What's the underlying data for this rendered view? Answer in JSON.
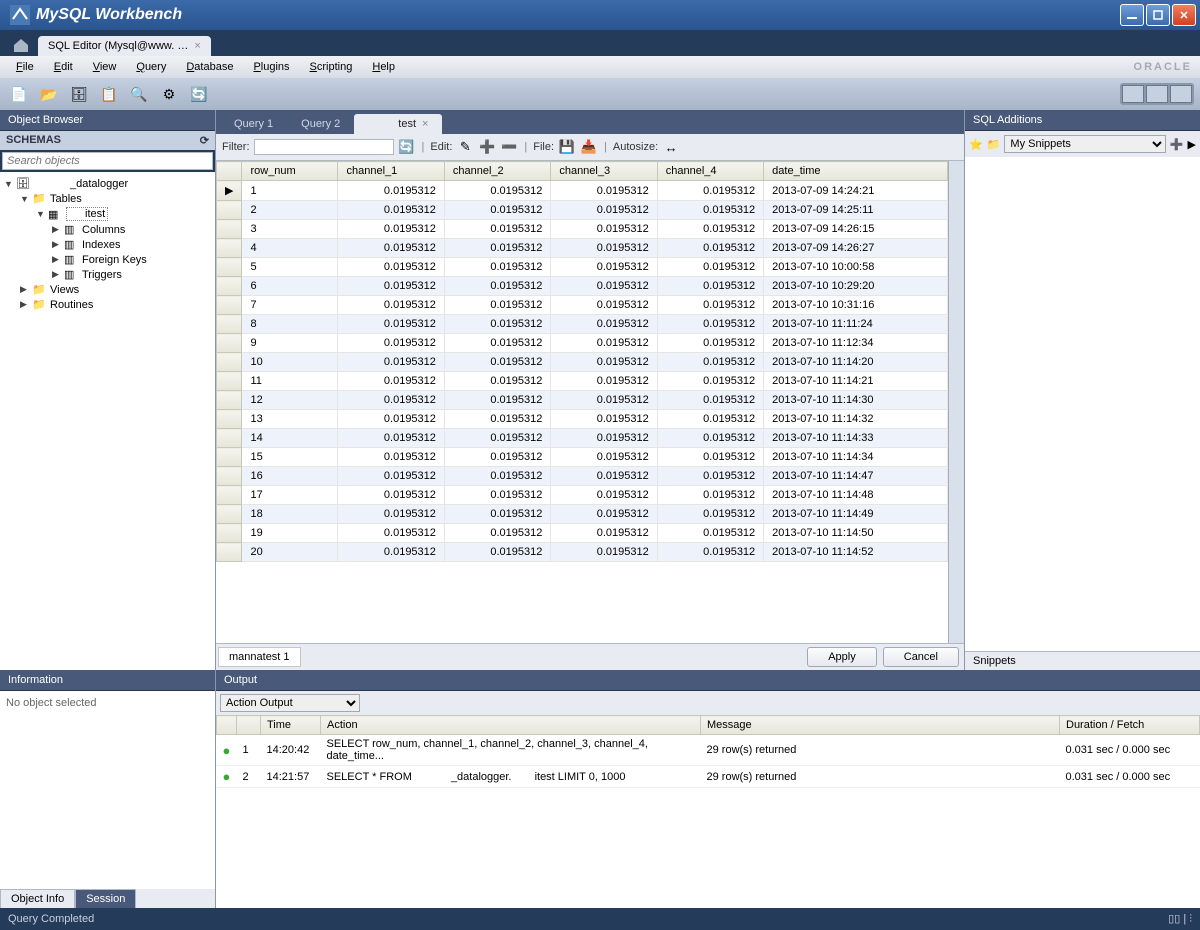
{
  "window": {
    "title": "MySQL Workbench"
  },
  "top_tab": {
    "label": "SQL Editor (Mysql@www. …"
  },
  "menu": [
    "File",
    "Edit",
    "View",
    "Query",
    "Database",
    "Plugins",
    "Scripting",
    "Help"
  ],
  "brand": "ORACLE",
  "object_browser": {
    "title": "Object Browser",
    "schemas_label": "SCHEMAS",
    "search_placeholder": "Search objects",
    "tree": {
      "db_suffix": "_datalogger",
      "tables": "Tables",
      "table_suffix": "itest",
      "columns": "Columns",
      "indexes": "Indexes",
      "foreign_keys": "Foreign Keys",
      "triggers": "Triggers",
      "views": "Views",
      "routines": "Routines"
    }
  },
  "information": {
    "title": "Information",
    "body": "No object selected"
  },
  "info_tabs": {
    "object": "Object Info",
    "session": "Session"
  },
  "query_tabs": {
    "q1": "Query 1",
    "q2": "Query 2",
    "active_suffix": "test"
  },
  "filter_bar": {
    "filter": "Filter:",
    "edit": "Edit:",
    "file": "File:",
    "autosize": "Autosize:"
  },
  "grid": {
    "columns": [
      "row_num",
      "channel_1",
      "channel_2",
      "channel_3",
      "channel_4",
      "date_time"
    ],
    "rows": [
      {
        "n": 1,
        "c": "0.0195312",
        "dt": "2013-07-09 14:24:21"
      },
      {
        "n": 2,
        "c": "0.0195312",
        "dt": "2013-07-09 14:25:11"
      },
      {
        "n": 3,
        "c": "0.0195312",
        "dt": "2013-07-09 14:26:15"
      },
      {
        "n": 4,
        "c": "0.0195312",
        "dt": "2013-07-09 14:26:27"
      },
      {
        "n": 5,
        "c": "0.0195312",
        "dt": "2013-07-10 10:00:58"
      },
      {
        "n": 6,
        "c": "0.0195312",
        "dt": "2013-07-10 10:29:20"
      },
      {
        "n": 7,
        "c": "0.0195312",
        "dt": "2013-07-10 10:31:16"
      },
      {
        "n": 8,
        "c": "0.0195312",
        "dt": "2013-07-10 11:11:24"
      },
      {
        "n": 9,
        "c": "0.0195312",
        "dt": "2013-07-10 11:12:34"
      },
      {
        "n": 10,
        "c": "0.0195312",
        "dt": "2013-07-10 11:14:20"
      },
      {
        "n": 11,
        "c": "0.0195312",
        "dt": "2013-07-10 11:14:21"
      },
      {
        "n": 12,
        "c": "0.0195312",
        "dt": "2013-07-10 11:14:30"
      },
      {
        "n": 13,
        "c": "0.0195312",
        "dt": "2013-07-10 11:14:32"
      },
      {
        "n": 14,
        "c": "0.0195312",
        "dt": "2013-07-10 11:14:33"
      },
      {
        "n": 15,
        "c": "0.0195312",
        "dt": "2013-07-10 11:14:34"
      },
      {
        "n": 16,
        "c": "0.0195312",
        "dt": "2013-07-10 11:14:47"
      },
      {
        "n": 17,
        "c": "0.0195312",
        "dt": "2013-07-10 11:14:48"
      },
      {
        "n": 18,
        "c": "0.0195312",
        "dt": "2013-07-10 11:14:49"
      },
      {
        "n": 19,
        "c": "0.0195312",
        "dt": "2013-07-10 11:14:50"
      },
      {
        "n": 20,
        "c": "0.0195312",
        "dt": "2013-07-10 11:14:52"
      }
    ],
    "result_tab": "mannatest 1",
    "apply": "Apply",
    "cancel": "Cancel"
  },
  "sql_additions": {
    "title": "SQL Additions",
    "snippets_select": "My Snippets",
    "snippets_tab": "Snippets"
  },
  "output": {
    "title": "Output",
    "dropdown": "Action Output",
    "columns": {
      "n": "",
      "time": "Time",
      "action": "Action",
      "message": "Message",
      "duration": "Duration / Fetch"
    },
    "rows": [
      {
        "n": 1,
        "time": "14:20:42",
        "action": "SELECT row_num, channel_1, channel_2, channel_3, channel_4, date_time...",
        "message": "29 row(s) returned",
        "duration": "0.031 sec / 0.000 sec"
      },
      {
        "n": 2,
        "time": "14:21:57",
        "action_prefix": "SELECT * FROM ",
        "action_mid": "_datalogger.",
        "action_suffix": "itest LIMIT 0, 1000",
        "message": "29 row(s) returned",
        "duration": "0.031 sec / 0.000 sec"
      }
    ]
  },
  "status": {
    "text": "Query Completed"
  }
}
